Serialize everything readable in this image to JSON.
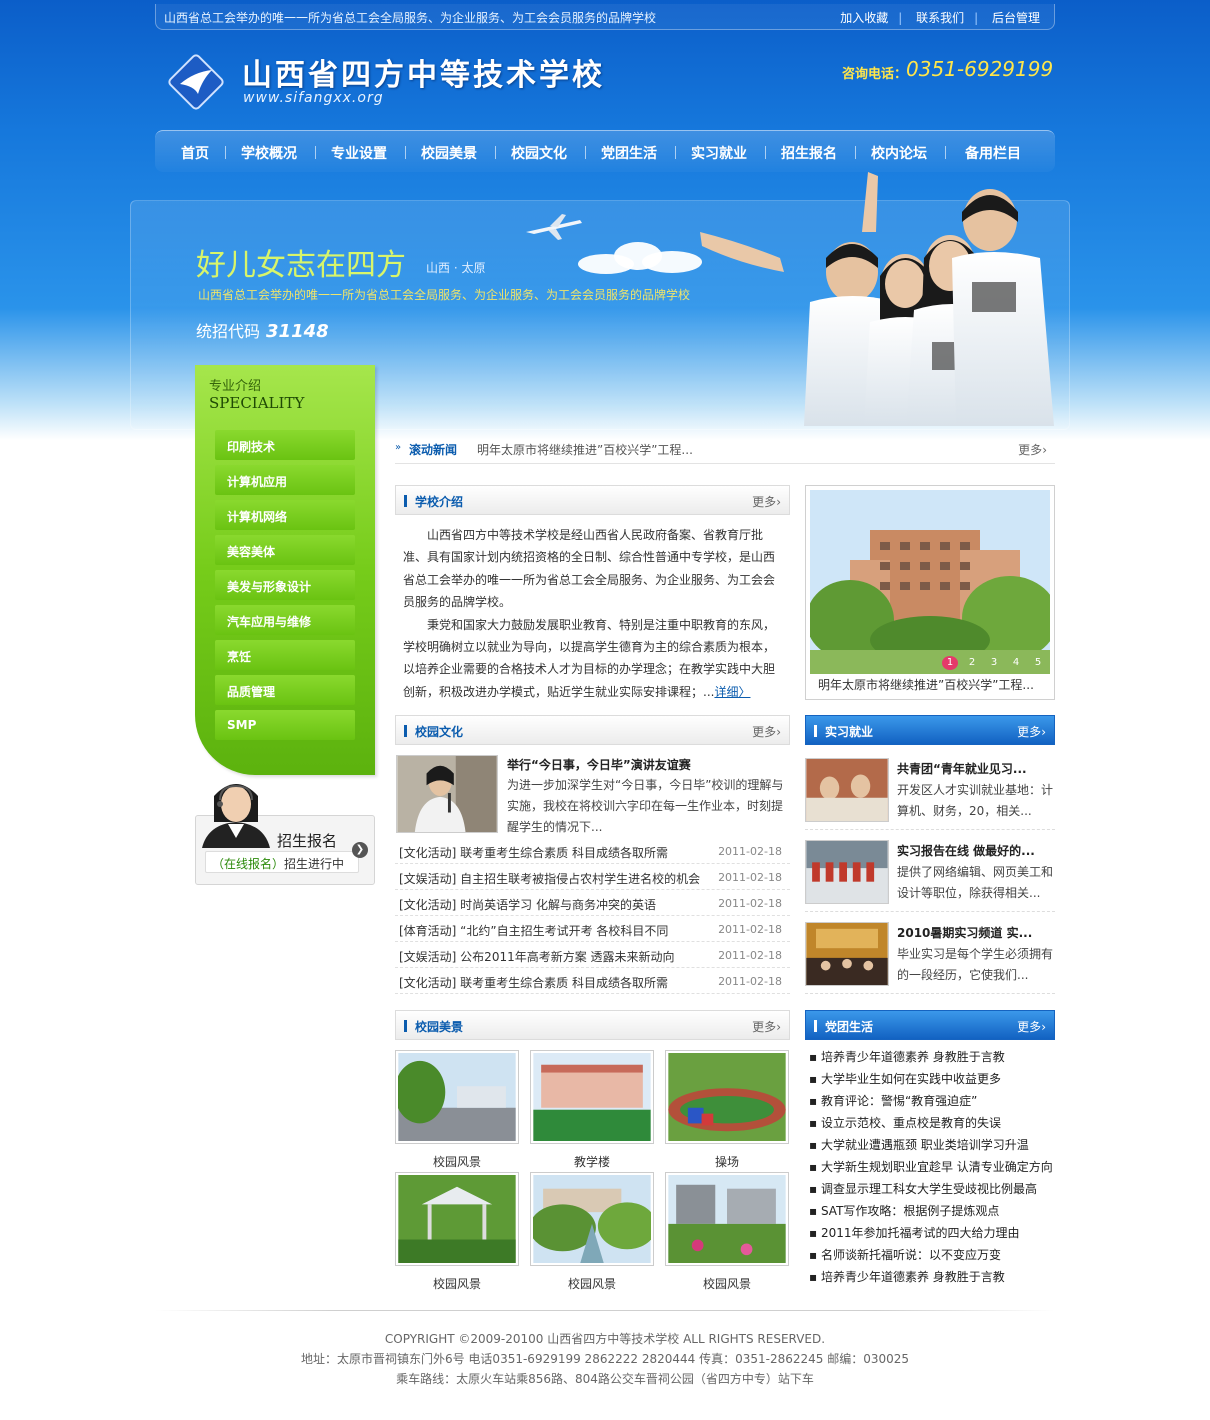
{
  "top": {
    "slogan": "山西省总工会举办的唯一一所为省总工会全局服务、为企业服务、为工会会员服务的品牌学校",
    "links": [
      "加入收藏",
      "联系我们",
      "后台管理"
    ]
  },
  "header": {
    "school_name": "山西省四方中等技术学校",
    "url": "www.sifangxx.org",
    "phone_label": "咨询电话：",
    "phone": "0351-6929199"
  },
  "nav": [
    "首页",
    "学校概况",
    "专业设置",
    "校园美景",
    "校园文化",
    "党团生活",
    "实习就业",
    "招生报名",
    "校内论坛",
    "备用栏目"
  ],
  "banner": {
    "title": "好儿女志在四方",
    "location": "山西 · 太原",
    "subtitle": "山西省总工会举办的唯一一所为省总工会全局服务、为企业服务、为工会会员服务的品牌学校",
    "code_label": "统招代码",
    "code": "31148"
  },
  "speciality": {
    "title_cn": "专业介绍",
    "title_en": "SPECIALITY",
    "items": [
      "印刷技术",
      "计算机应用",
      "计算机网络",
      "美容美体",
      "美发与形象设计",
      "汽车应用与维修",
      "烹饪",
      "品质管理",
      "SMP"
    ]
  },
  "enroll": {
    "title": "招生报名",
    "sub_link": "（在线报名）",
    "sub_text": "招生进行中"
  },
  "ticker": {
    "label": "滚动新闻",
    "text": "明年太原市将继续推进”百校兴学”工程...",
    "more": "更多"
  },
  "intro": {
    "title": "学校介绍",
    "more": "更多",
    "p1": "山西省四方中等技术学校是经山西省人民政府备案、省教育厅批准、具有国家计划内统招资格的全日制、综合性普通中专学校，是山西省总工会举办的唯一一所为省总工会全局服务、为企业服务、为工会会员服务的品牌学校。",
    "p2": "秉党和国家大力鼓励发展职业教育、特别是注重中职教育的东风，学校明确树立以就业为导向，以提高学生德育为主的综合素质为根本，以培养企业需要的合格技术人才为目标的办学理念；在教学实践中大胆创新，积极改进办学模式，贴近学生就业实际安排课程；...",
    "detail": "详细"
  },
  "photo": {
    "caption": "明年太原市将继续推进”百校兴学”工程...",
    "pages": [
      "1",
      "2",
      "3",
      "4",
      "5"
    ]
  },
  "culture": {
    "title": "校园文化",
    "more": "更多",
    "feature_title": "举行“今日事，今日毕”演讲友谊赛",
    "feature_desc": "为进一步加深学生对“今日事，今日毕”校训的理解与实施，我校在将校训六字印在每一生作业本，时刻提醒学生的情况下...",
    "news": [
      {
        "text": "[文化活动] 联考重考生综合素质 科目成绩各取所需",
        "date": "2011-02-18"
      },
      {
        "text": "[文娱活动] 自主招生联考被指侵占农村学生进名校的机会",
        "date": "2011-02-18"
      },
      {
        "text": "[文化活动] 时尚英语学习 化解与商务冲突的英语",
        "date": "2011-02-18"
      },
      {
        "text": "[体育活动] “北约”自主招生考试开考 各校科目不同",
        "date": "2011-02-18"
      },
      {
        "text": "[文娱活动] 公布2011年高考新方案 透露未来新动向",
        "date": "2011-02-18"
      },
      {
        "text": "[文化活动] 联考重考生综合素质 科目成绩各取所需",
        "date": "2011-02-18"
      }
    ]
  },
  "scenery": {
    "title": "校园美景",
    "more": "更多",
    "items": [
      "校园风景",
      "教学楼",
      "操场",
      "校园风景",
      "校园风景",
      "校园风景"
    ]
  },
  "intern": {
    "title": "实习就业",
    "more": "更多",
    "items": [
      {
        "title": "共青团“青年就业见习...",
        "desc": "开发区人才实训就业基地：计算机、财务，20，相关..."
      },
      {
        "title": "实习报告在线 做最好的...",
        "desc": "提供了网络编辑、网页美工和设计等职位，除获得相关..."
      },
      {
        "title": "2010暑期实习频道 实...",
        "desc": "毕业实习是每个学生必须拥有的一段经历，它使我们..."
      }
    ]
  },
  "party": {
    "title": "党团生活",
    "more": "更多",
    "items": [
      "培养青少年道德素养 身教胜于言教",
      "大学毕业生如何在实践中收益更多",
      "教育评论：警惕“教育强迫症”",
      "设立示范校、重点校是教育的失误",
      "大学就业遭遇瓶颈 职业类培训学习升温",
      "大学新生规划职业宜趁早 认清专业确定方向",
      "调查显示理工科女大学生受歧视比例最高",
      "SAT写作攻略：根据例子提炼观点",
      "2011年参加托福考试的四大给力理由",
      "名师谈新托福听说：以不变应万变",
      "培养青少年道德素养 身教胜于言教"
    ]
  },
  "footer": {
    "copyright": "COPYRIGHT ©2009-20100 山西省四方中等技术学校 ALL RIGHTS RESERVED.",
    "address": "地址：太原市晋祠镇东门外6号    电话0351-6929199 2862222 2820444    传真：0351-2862245    邮编：030025",
    "route": "乘车路线：太原火车站乘856路、804路公交车晋祠公园（省四方中专）站下车"
  },
  "colors": {
    "brand_blue": "#0b5cae",
    "nav_bg": "#1678dc",
    "spec_green": "#76cc1a",
    "phone_yellow": "#ffe64a"
  }
}
